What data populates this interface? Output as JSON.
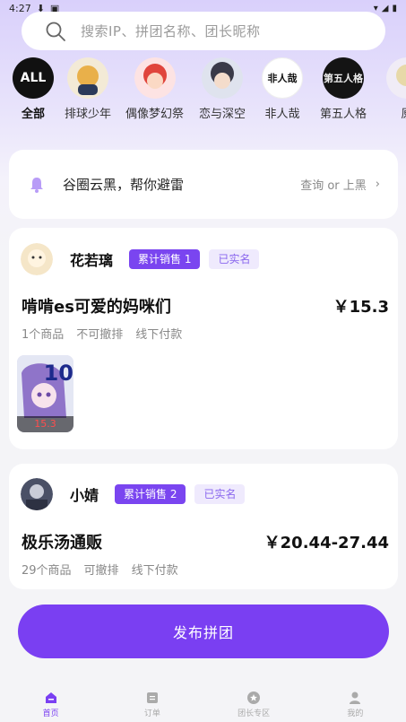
{
  "status_bar": {
    "time": "4:27"
  },
  "search": {
    "placeholder": "搜索IP、拼团名称、团长昵称"
  },
  "categories": [
    {
      "label": "全部",
      "avatar_text": "ALL",
      "active": true
    },
    {
      "label": "排球少年",
      "active": false
    },
    {
      "label": "偶像梦幻祭",
      "active": false
    },
    {
      "label": "恋与深空",
      "active": false
    },
    {
      "label": "非人哉",
      "avatar_text": "非人哉",
      "active": false
    },
    {
      "label": "第五人格",
      "avatar_text": "第五人格",
      "active": false
    },
    {
      "label": "原",
      "active": false
    }
  ],
  "notice": {
    "text": "谷圈云黑，帮你避雷",
    "link": "查询 or 上黑"
  },
  "groups": [
    {
      "seller": "花若璃",
      "sales_badge": "累计销售 1",
      "verified_badge": "已实名",
      "title": "啃啃es可爱的妈咪们",
      "price": "￥15.3",
      "meta": [
        "1个商品",
        "不可撤排",
        "线下付款"
      ],
      "thumb_price": "15.3",
      "thumb_text": "10"
    },
    {
      "seller": "小婧",
      "sales_badge": "累计销售 2",
      "verified_badge": "已实名",
      "title": "极乐汤通贩",
      "price": "￥20.44-27.44",
      "meta": [
        "29个商品",
        "可撤排",
        "线下付款"
      ]
    }
  ],
  "publish_button": "发布拼团",
  "tabs": [
    {
      "label": "首页",
      "active": true
    },
    {
      "label": "订单",
      "active": false
    },
    {
      "label": "团长专区",
      "active": false
    },
    {
      "label": "我的",
      "active": false
    }
  ],
  "colors": {
    "accent": "#7a3ff2",
    "badge_bg": "#efeafd"
  }
}
